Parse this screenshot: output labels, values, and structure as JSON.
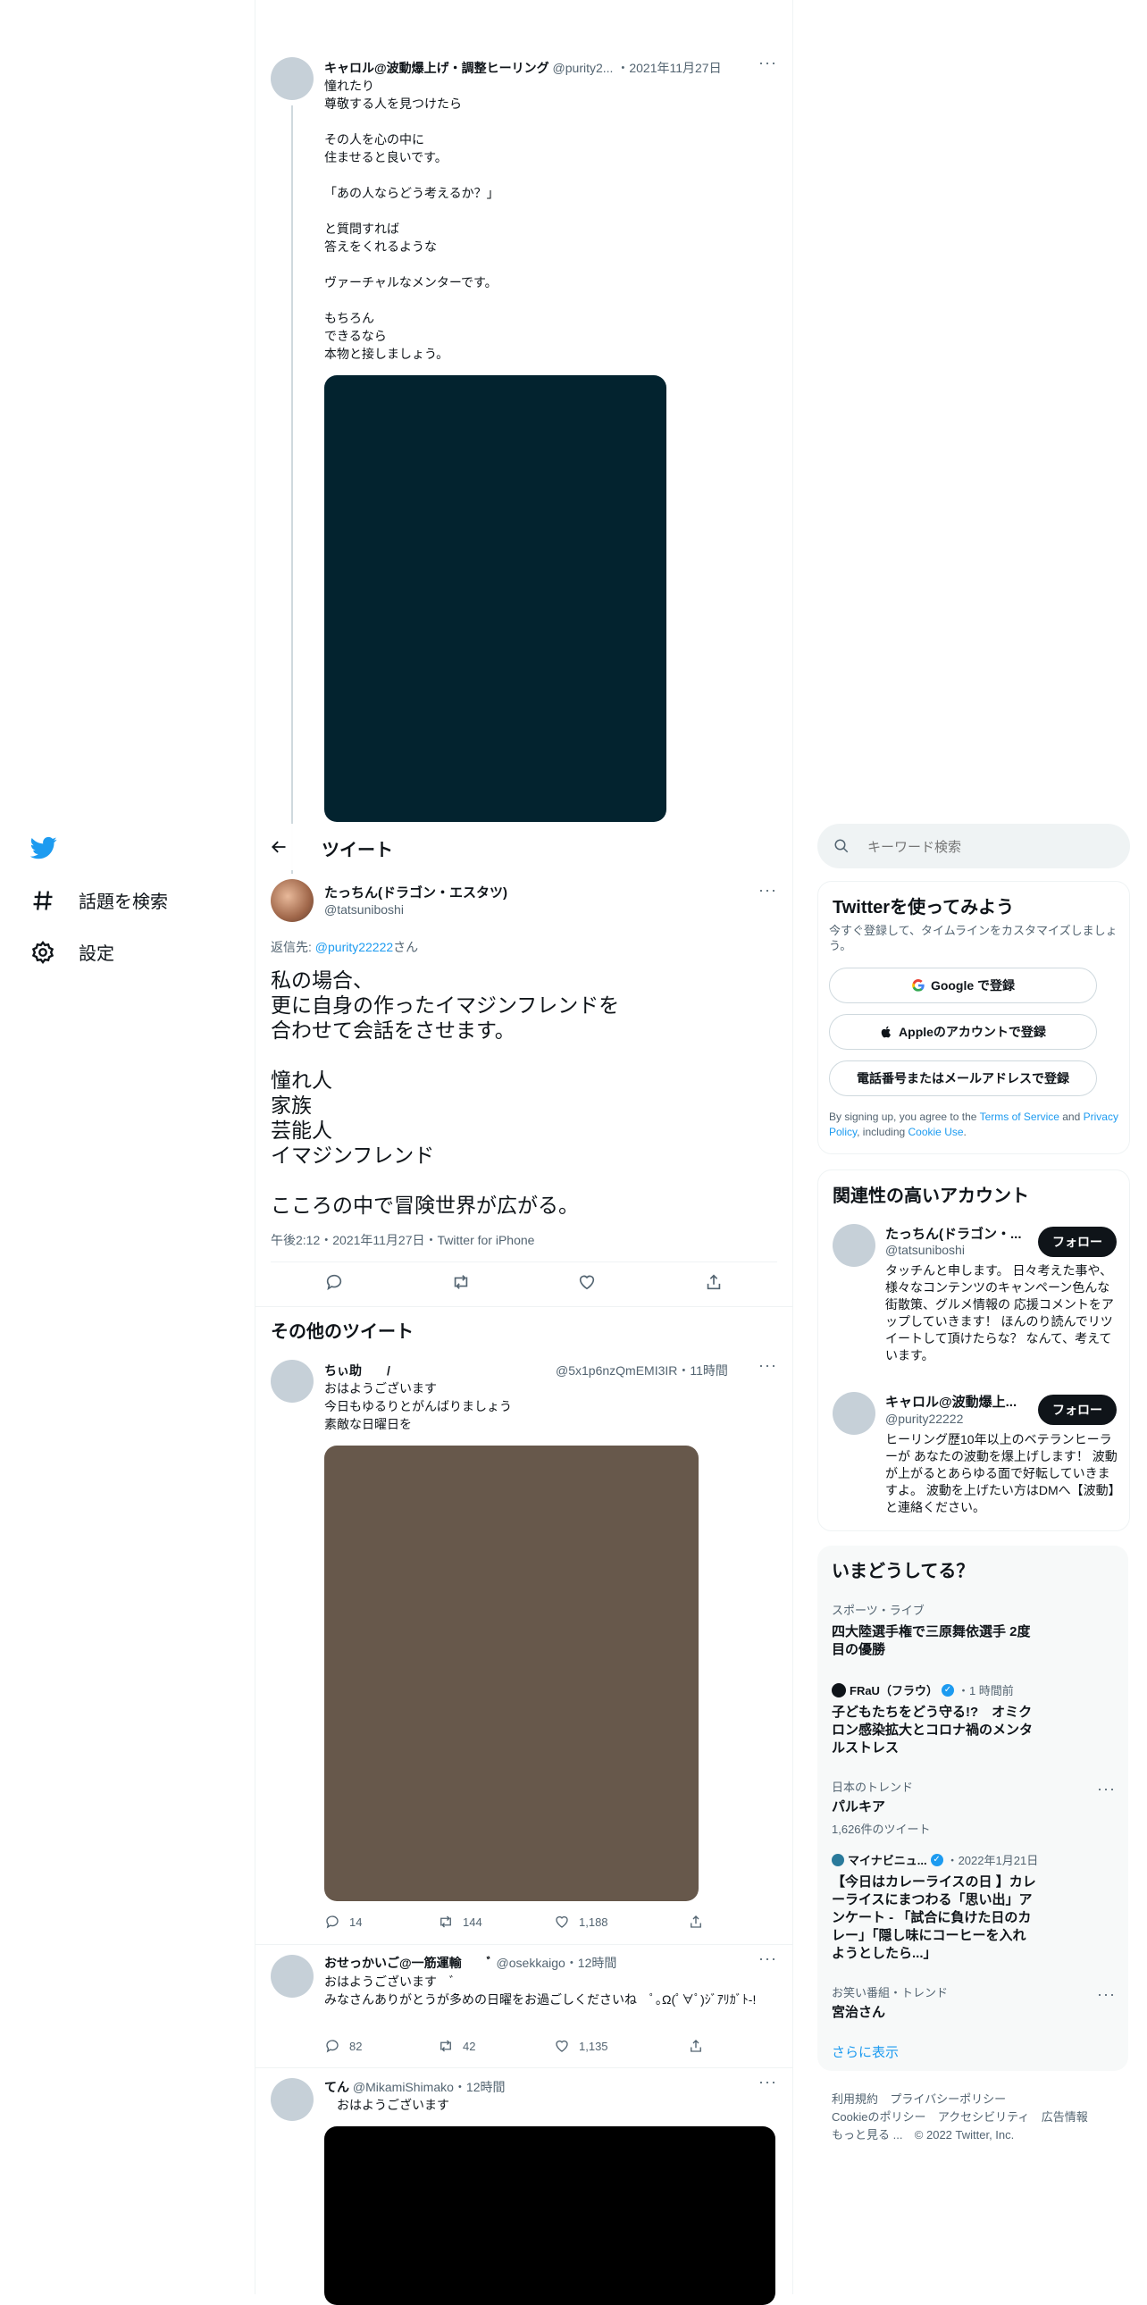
{
  "colors": {
    "accent": "#1d9bf0",
    "text": "#0f1419",
    "muted": "#536471",
    "media1": "#03232f",
    "media2": "#67584b",
    "media3": "#000000"
  },
  "nav": {
    "logo": "twitter-bird-icon",
    "explore": "話題を検索",
    "settings": "設定"
  },
  "header": {
    "back_icon": "arrow-left-icon",
    "title": "ツイート"
  },
  "parent_tweet": {
    "name": "キャロル@波動爆上げ・調整ヒーリング",
    "handle": "@purity2...",
    "date": "・2021年11月27日",
    "text": "憧れたり\n尊敬する人を見つけたら\n\nその人を心の中に\n住ませると良いです。\n\n「あの人ならどう考えるか？」\n\nと質問すれば\n答えをくれるような\n\nヴァーチャルなメンターです。\n\nもちろん\nできるなら\n本物と接しましょう。"
  },
  "main_tweet": {
    "name": "たっちん(ドラゴン・エスタツ)",
    "handle": "@tatsuniboshi",
    "reply_prefix": "返信先: ",
    "reply_to": "@purity22222",
    "reply_suffix": "さん",
    "text": "私の場合、\n更に自身の作ったイマジンフレンドを\n合わせて会話をさせます。\n\n憧れ人\n家族\n芸能人\nイマジンフレンド\n\nこころの中で冒険世界が広がる。",
    "meta": "午後2:12・2021年11月27日・Twitter for iPhone"
  },
  "more_section_title": "その他のツイート",
  "more_tweets": [
    {
      "name": "ちぃ助　　/",
      "handle": "@5x1p6nzQmEMI3IR",
      "time": "・11時間",
      "text": "おはようございます\n今日もゆるりとがんばりましょう\n素敵な日曜日を",
      "replies": "14",
      "retweets": "144",
      "likes": "1,188"
    },
    {
      "name": "おせっかいご@一筋運輸　　ﾞ",
      "handle": "@osekkaigo",
      "time": "・12時間",
      "text": "おはようございます　ﾞ\nみなさんありがとうが多めの日曜をお過ごしくださいね　ﾟ｡Ω(ﾟ∀ﾟ)ｼﾞｱﾘｶﾞﾄ-!",
      "replies": "82",
      "retweets": "42",
      "likes": "1,135"
    },
    {
      "name": "てん",
      "handle": "@MikamiShimako",
      "time": "・12時間",
      "text": "　おはようございます"
    }
  ],
  "search": {
    "placeholder": "キーワード検索"
  },
  "signup": {
    "title": "Twitterを使ってみよう",
    "subtitle": "今すぐ登録して、タイムラインをカスタマイズしましょう。",
    "google": "Google で登録",
    "apple": "Appleのアカウントで登録",
    "phone": "電話番号またはメールアドレスで登録",
    "legal_1": "By signing up, you agree to the ",
    "tos": "Terms of Service",
    "legal_2": " and ",
    "privacy": "Privacy Policy",
    "legal_3": ", including ",
    "cookie": "Cookie Use",
    "legal_4": "."
  },
  "relevant": {
    "title": "関連性の高いアカウント",
    "follow_label": "フォロー",
    "accounts": [
      {
        "name": "たっちん(ドラゴン・...",
        "handle": "@tatsuniboshi",
        "bio": "タッチんと申します。 日々考えた事や、様々なコンテンツのキャンペーン色んな街散策、グルメ情報の 応援コメントをアップしていきます！ ほんのり読んでリツイートして頂けたらな？ なんて、考えています。"
      },
      {
        "name": "キャロル@波動爆上...",
        "handle": "@purity22222",
        "bio": "ヒーリング歴10年以上のベテランヒーラーが あなたの波動を爆上げします！ 波動が上がるとあらゆる面で好転していきますよ。 波動を上げたい方はDMへ【波動】と連絡ください。"
      }
    ]
  },
  "trends": {
    "title": "いまどうしてる？",
    "items": [
      {
        "category": "スポーツ・ライブ",
        "title": "四大陸選手権で三原舞依選手 2度\n目の優勝"
      },
      {
        "source": "FRaU（フラウ）",
        "time": "・1 時間前",
        "title": "子どもたちをどう守る!?　オミク\nロン感染拡大とコロナ禍のメンタ\nルストレス"
      },
      {
        "category": "日本のトレンド",
        "title": "パルキア",
        "count": "1,626件のツイート"
      },
      {
        "source": "マイナビニュ...",
        "time": "・2022年1月21日",
        "title": "【今日はカレーライスの日 】カレ\nーライスにまつわる「思い出」ア\nンケート - 「試合に負けた日のカ\nレー」「隠し味にコーヒーを入れ\nようとしたら...」"
      },
      {
        "category": "お笑い番組・トレンド",
        "title": "宮治さん"
      }
    ],
    "show_more": "さらに表示"
  },
  "footer": {
    "links": [
      "利用規約",
      "プライバシーポリシー",
      "Cookieのポリシー",
      "アクセシビリティ",
      "広告情報",
      "もっと見る ..."
    ],
    "copyright": "© 2022 Twitter, Inc."
  }
}
